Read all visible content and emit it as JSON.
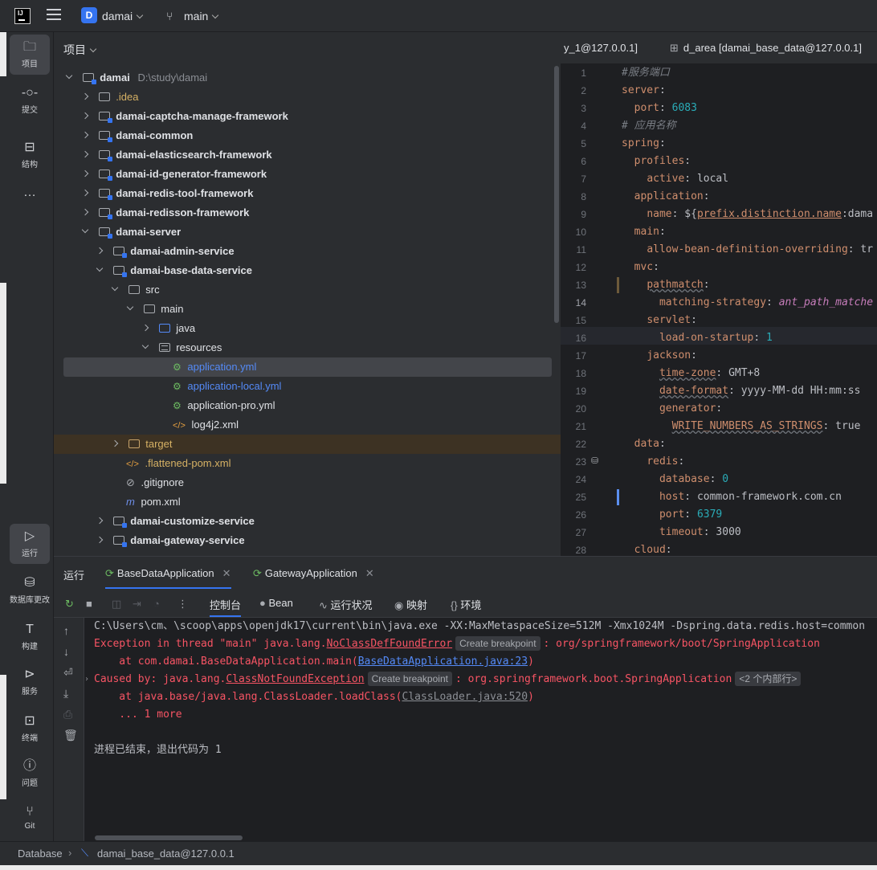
{
  "titlebar": {
    "project_badge": "D",
    "project_name": "damai",
    "branch_icon": "git-branch-icon",
    "branch": "main"
  },
  "toolstrip": {
    "items": [
      {
        "label": "项目",
        "icon": "folder-icon"
      },
      {
        "label": "提交",
        "icon": "commit-icon"
      },
      {
        "label": "结构",
        "icon": "structure-icon"
      },
      {
        "label": "…",
        "icon": "more-icon"
      },
      {
        "label": "运行",
        "icon": "run-icon"
      },
      {
        "label": "数据库更改",
        "icon": "database-icon"
      },
      {
        "label": "构建",
        "icon": "build-icon"
      },
      {
        "label": "服务",
        "icon": "services-icon"
      },
      {
        "label": "终端",
        "icon": "terminal-icon"
      },
      {
        "label": "问题",
        "icon": "problems-icon"
      },
      {
        "label": "Git",
        "icon": "git-icon"
      }
    ]
  },
  "project": {
    "header": "项目",
    "tree": [
      {
        "name": "damai",
        "path": "D:\\study\\damai"
      },
      {
        "name": ".idea"
      },
      {
        "name": "damai-captcha-manage-framework"
      },
      {
        "name": "damai-common"
      },
      {
        "name": "damai-elasticsearch-framework"
      },
      {
        "name": "damai-id-generator-framework"
      },
      {
        "name": "damai-redis-tool-framework"
      },
      {
        "name": "damai-redisson-framework"
      },
      {
        "name": "damai-server"
      },
      {
        "name": "damai-admin-service"
      },
      {
        "name": "damai-base-data-service"
      },
      {
        "name": "src"
      },
      {
        "name": "main"
      },
      {
        "name": "java"
      },
      {
        "name": "resources"
      },
      {
        "name": "application.yml"
      },
      {
        "name": "application-local.yml"
      },
      {
        "name": "application-pro.yml"
      },
      {
        "name": "log4j2.xml"
      },
      {
        "name": "target"
      },
      {
        "name": ".flattened-pom.xml"
      },
      {
        "name": ".gitignore"
      },
      {
        "name": "pom.xml"
      },
      {
        "name": "damai-customize-service"
      },
      {
        "name": "damai-gateway-service"
      }
    ]
  },
  "editor": {
    "tab1": "y_1@127.0.0.1]",
    "tab2": "d_area [damai_base_data@127.0.0.1]",
    "line_numbers": [
      "1",
      "2",
      "3",
      "4",
      "5",
      "6",
      "7",
      "8",
      "9",
      "10",
      "11",
      "12",
      "13",
      "14",
      "15",
      "16",
      "17",
      "18",
      "19",
      "20",
      "21",
      "22",
      "23",
      "24",
      "25",
      "26",
      "27",
      "28"
    ],
    "code": {
      "l1": "#服务端口",
      "l2": "server",
      "l3_key": "port",
      "l3_val": "6083",
      "l4": "# 应用名称",
      "l5": "spring",
      "l6": "profiles",
      "l7_key": "active",
      "l7_val": "local",
      "l8": "application",
      "l9_key": "name",
      "l9_a": "${",
      "l9_b": "prefix.distinction.name",
      "l9_c": ":dama",
      "l10": "main",
      "l11_key": "allow-bean-definition-overriding",
      "l11_val": "tr",
      "l12": "mvc",
      "l13": "pathmatch",
      "l14_key": "matching-strategy",
      "l14_val": "ant_path_matche",
      "l15": "servlet",
      "l16_key": "load-on-startup",
      "l16_val": "1",
      "l17": "jackson",
      "l18_key": "time-zone",
      "l18_val": "GMT+8",
      "l19_key": "date-format",
      "l19_val": "yyyy-MM-dd HH:mm:ss",
      "l20": "generator",
      "l21_key": "WRITE_NUMBERS_AS_STRINGS",
      "l21_val": "true",
      "l22": "data",
      "l23": "redis",
      "l24_key": "database",
      "l24_val": "0",
      "l25_key": "host",
      "l25_val": "common-framework.com.cn",
      "l26_key": "port",
      "l26_val": "6379",
      "l27_key": "timeout",
      "l27_val": "3000",
      "l28": "cloud"
    }
  },
  "run": {
    "title": "运行",
    "tabs": [
      {
        "label": "BaseDataApplication"
      },
      {
        "label": "GatewayApplication"
      }
    ],
    "subtabs": [
      {
        "label": "控制台"
      },
      {
        "label": "Bean"
      },
      {
        "label": "运行状况"
      },
      {
        "label": "映射"
      },
      {
        "label": "环境"
      }
    ],
    "console": {
      "cmd": "C:\\Users\\cm、\\scoop\\apps\\openjdk17\\current\\bin\\java.exe -XX:MaxMetaspaceSize=512M -Xmx1024M -Dspring.data.redis.host=common",
      "ex_prefix": "Exception in thread \"main\" java.lang.",
      "ex_class": "NoClassDefFoundError",
      "ex_chip": "Create breakpoint",
      "ex_msg": ": org/springframework/boot/SpringApplication",
      "at1_prefix": "    at com.damai.BaseDataApplication.main(",
      "at1_link": "BaseDataApplication.java:23",
      "at1_suffix": ")",
      "caused_prefix": "Caused by: java.lang.",
      "caused_class": "ClassNotFoundException",
      "caused_chip": "Create breakpoint",
      "caused_msg": ": org.springframework.boot.SpringApplication",
      "caused_internal": "<2 个内部行>",
      "at2_prefix": "    at java.base/java.lang.ClassLoader.loadClass(",
      "at2_link": "ClassLoader.java:520",
      "at2_suffix": ")",
      "more": "    ... 1 more",
      "exit": "进程已结束，退出代码为 1"
    }
  },
  "statusbar": {
    "crumb1": "Database",
    "crumb2": "damai_base_data@127.0.0.1"
  }
}
